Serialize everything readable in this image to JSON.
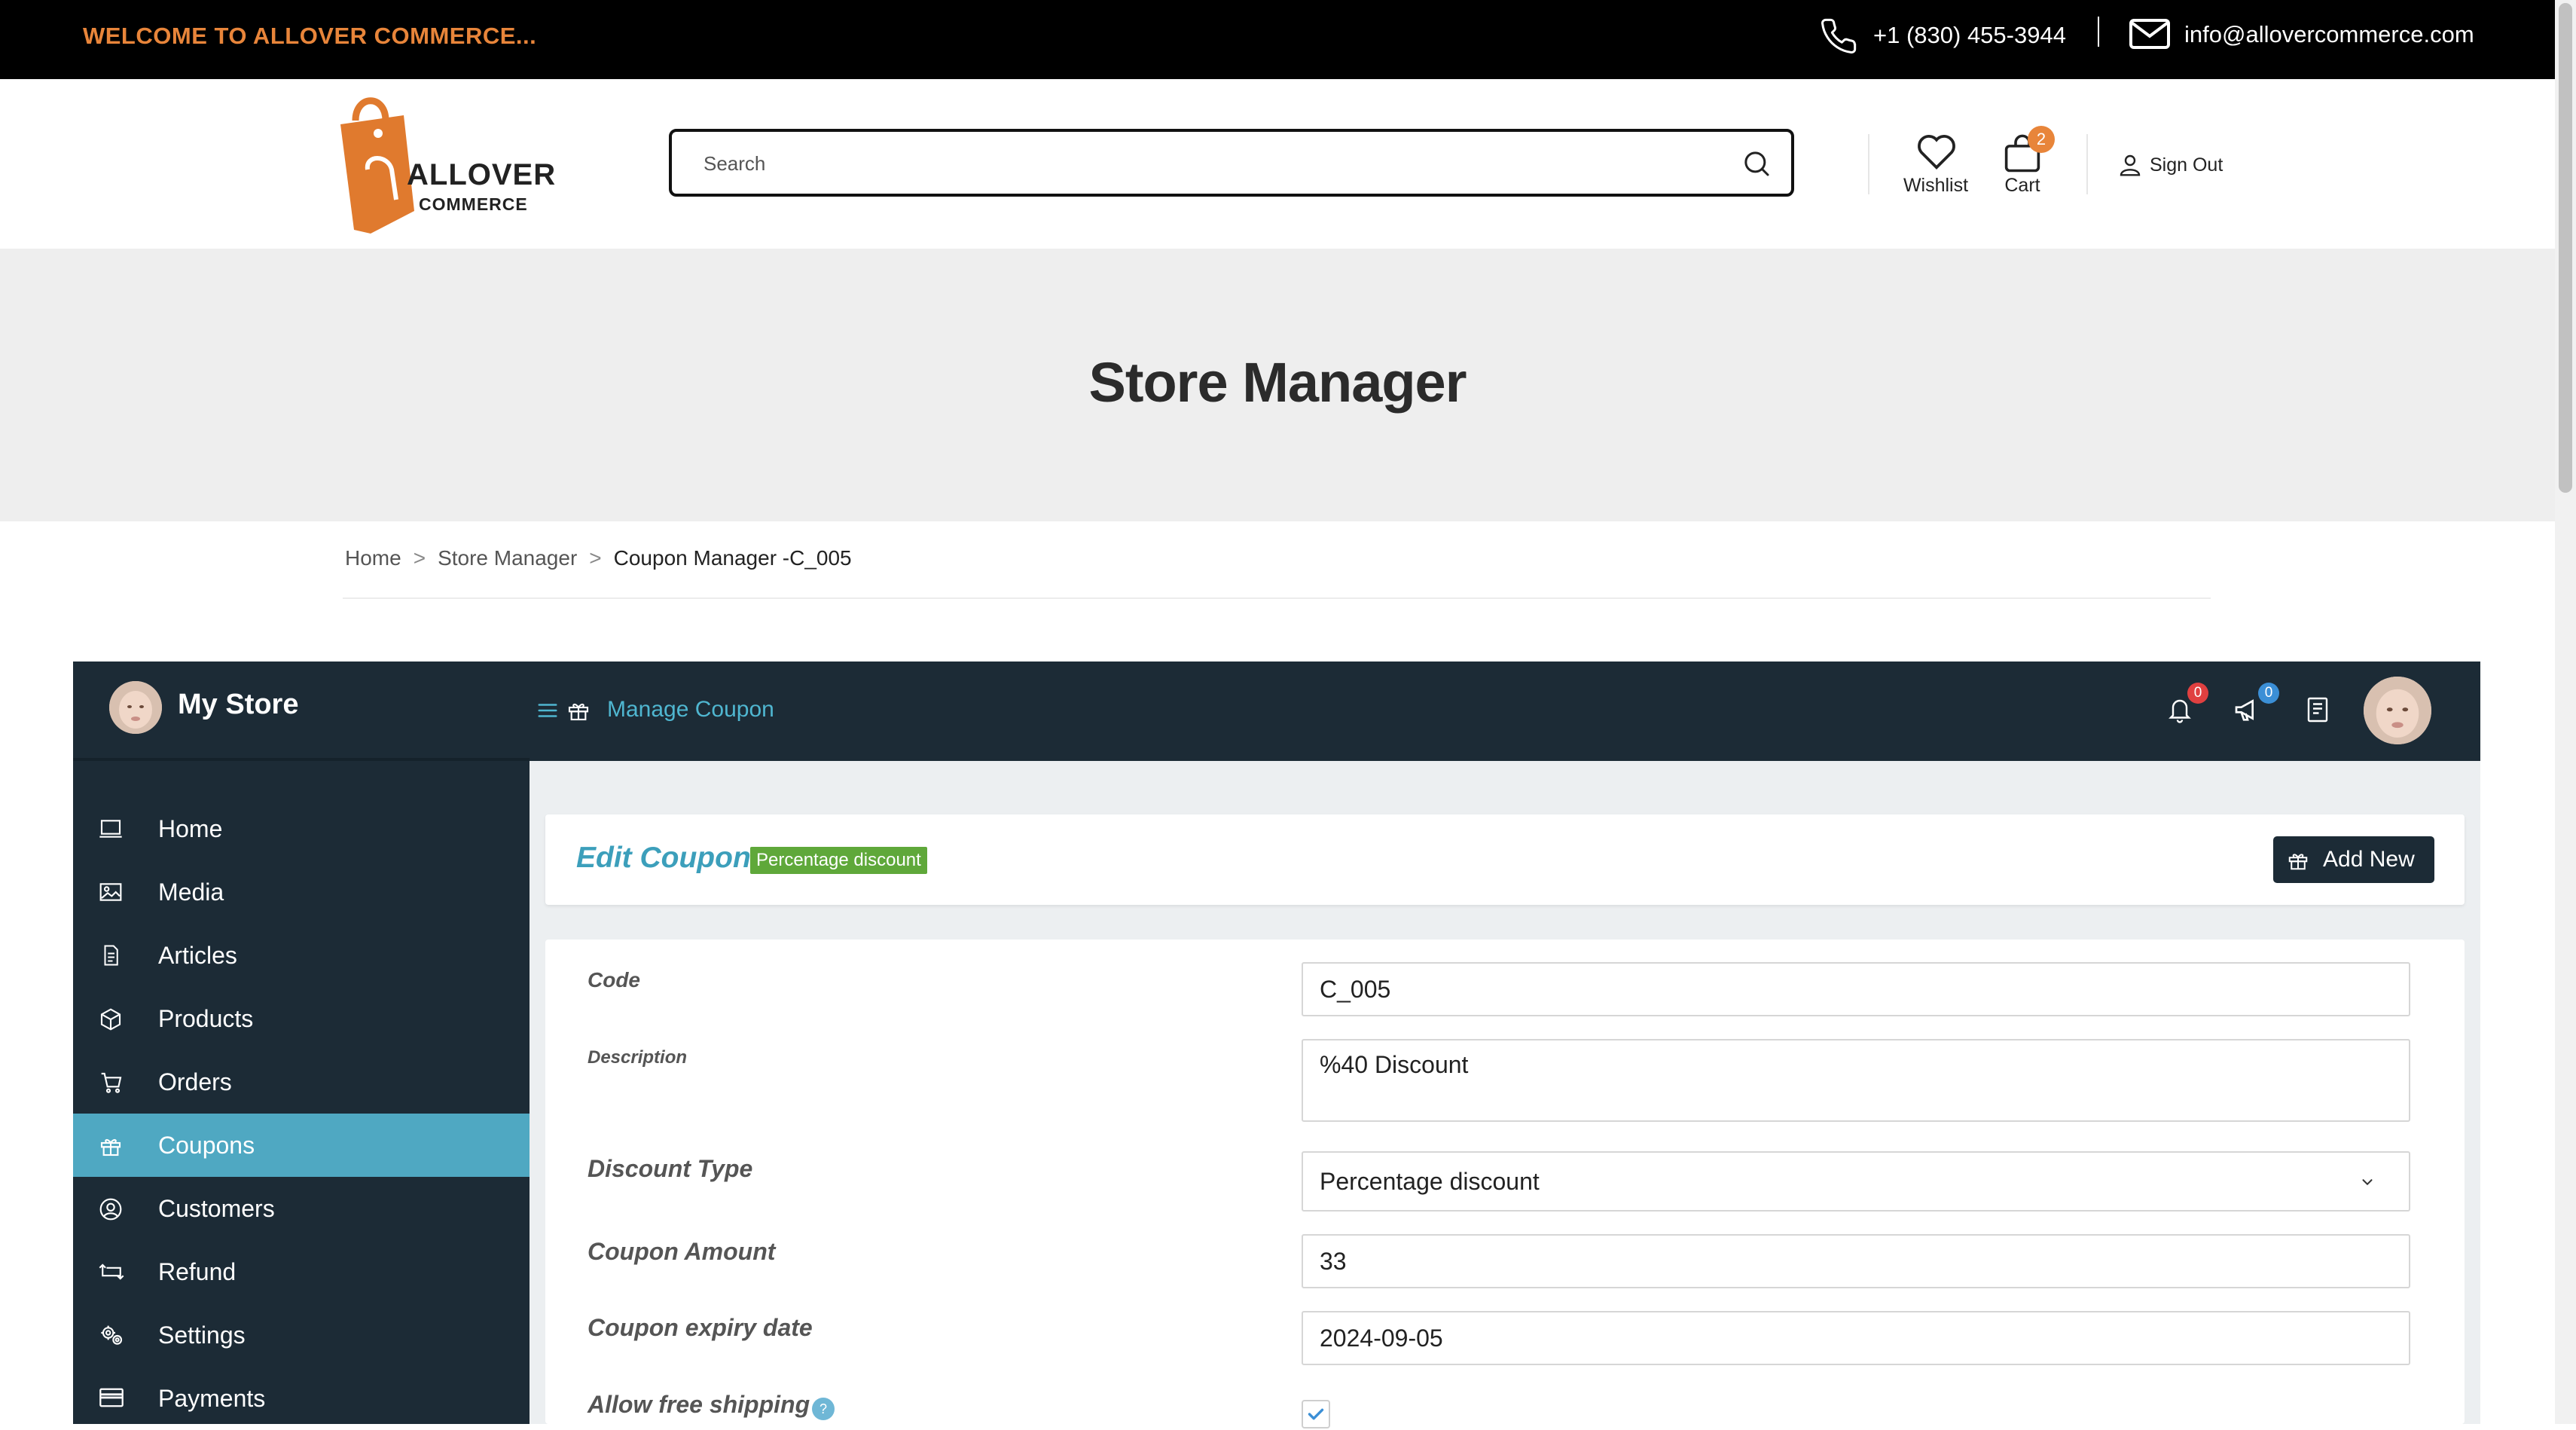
{
  "topbar": {
    "welcome": "WELCOME TO ALLOVER COMMERCE...",
    "phone": "+1 (830) 455-3944",
    "email": "info@allovercommerce.com"
  },
  "header": {
    "logo_line1": "ALLOVER",
    "logo_line2": "COMMERCE",
    "search_placeholder": "Search",
    "wishlist_label": "Wishlist",
    "cart_label": "Cart",
    "cart_count": "2",
    "signout_label": "Sign Out"
  },
  "hero": {
    "title": "Store Manager"
  },
  "breadcrumb": {
    "home": "Home",
    "store_manager": "Store Manager",
    "current": "Coupon Manager -C_005"
  },
  "dashboard": {
    "store_name": "My Store",
    "section_title": "Manage Coupon",
    "notifications_count": "0",
    "announcements_count": "0"
  },
  "sidebar": {
    "items": [
      {
        "label": "Home",
        "icon": "monitor-icon"
      },
      {
        "label": "Media",
        "icon": "image-icon"
      },
      {
        "label": "Articles",
        "icon": "document-icon"
      },
      {
        "label": "Products",
        "icon": "cube-icon"
      },
      {
        "label": "Orders",
        "icon": "cart-icon"
      },
      {
        "label": "Coupons",
        "icon": "gift-icon",
        "active": true
      },
      {
        "label": "Customers",
        "icon": "user-circle-icon"
      },
      {
        "label": "Refund",
        "icon": "refund-icon"
      },
      {
        "label": "Settings",
        "icon": "gears-icon"
      },
      {
        "label": "Payments",
        "icon": "credit-card-icon"
      }
    ]
  },
  "edit": {
    "title": "Edit Coupon",
    "type_badge": "Percentage discount",
    "add_new_label": "Add New"
  },
  "form": {
    "code_label": "Code",
    "code_value": "C_005",
    "description_label": "Description",
    "description_value": "%40 Discount",
    "discount_type_label": "Discount Type",
    "discount_type_value": "Percentage discount",
    "coupon_amount_label": "Coupon Amount",
    "coupon_amount_value": "33",
    "expiry_label": "Coupon expiry date",
    "expiry_value": "2024-09-05",
    "free_shipping_label": "Allow free shipping",
    "free_shipping_help": "?",
    "free_shipping_checked": true
  },
  "colors": {
    "accent_orange": "#e8853a",
    "dashboard_dark": "#1c2b36",
    "active_item": "#4fa8c2",
    "link_blue": "#4fb6d0",
    "badge_green": "#5fa83a"
  }
}
